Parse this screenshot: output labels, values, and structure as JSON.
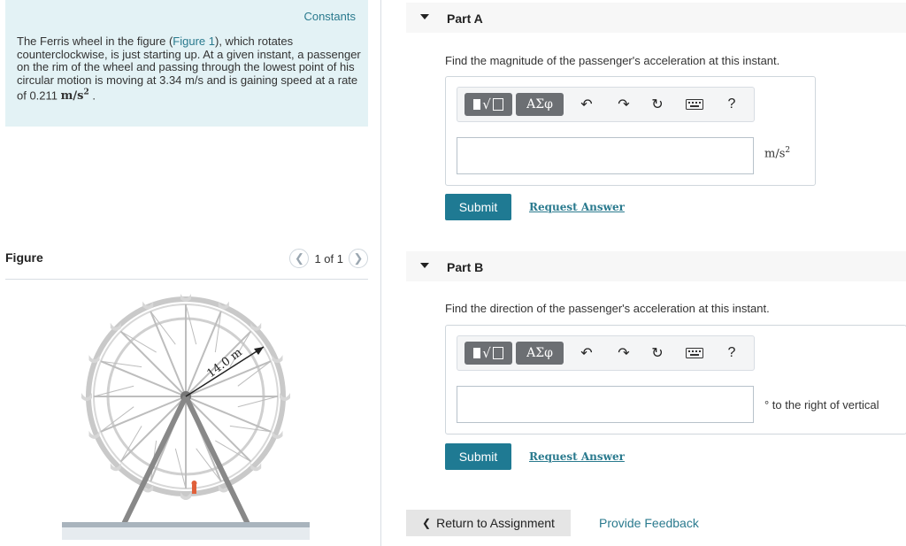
{
  "problem": {
    "constants_label": "Constants",
    "text_pre": "The Ferris wheel in the figure (",
    "figure_link": "Figure 1",
    "text_mid": "), which rotates counterclockwise, is just starting up. At a given instant, a passenger on the rim of the wheel and passing through the lowest point of his circular motion is moving at 3.34 m/s and is gaining speed at a rate of 0.211 ",
    "rate_unit": "m/s",
    "rate_unit_exp": "2",
    "text_end": " ."
  },
  "figure": {
    "title": "Figure",
    "pager_text": "1 of 1",
    "prev_icon": "chevron-left-icon",
    "next_icon": "chevron-right-icon",
    "radius_label": "14.0 m"
  },
  "toolbar": {
    "greek_label": "ΑΣφ",
    "help_label": "?",
    "icons": [
      "templates-icon",
      "greek-letters-icon",
      "undo-icon",
      "redo-icon",
      "reset-icon",
      "keyboard-icon",
      "help-icon"
    ]
  },
  "part_a": {
    "title": "Part A",
    "question": "Find the magnitude of the passenger's acceleration at this instant.",
    "answer_value": "",
    "unit": "m/s",
    "unit_exp": "2",
    "submit_label": "Submit",
    "request_label": "Request Answer"
  },
  "part_b": {
    "title": "Part B",
    "question": "Find the direction of the passenger's acceleration at this instant.",
    "answer_value": "",
    "unit": "° to the right of vertical",
    "submit_label": "Submit",
    "request_label": "Request Answer"
  },
  "footer": {
    "return_label": "Return to Assignment",
    "feedback_label": "Provide Feedback"
  },
  "colors": {
    "accent": "#1f7a93",
    "link": "#2a7a8e",
    "problem_bg": "#e3f2f5",
    "button_dark": "#6c6f73"
  }
}
